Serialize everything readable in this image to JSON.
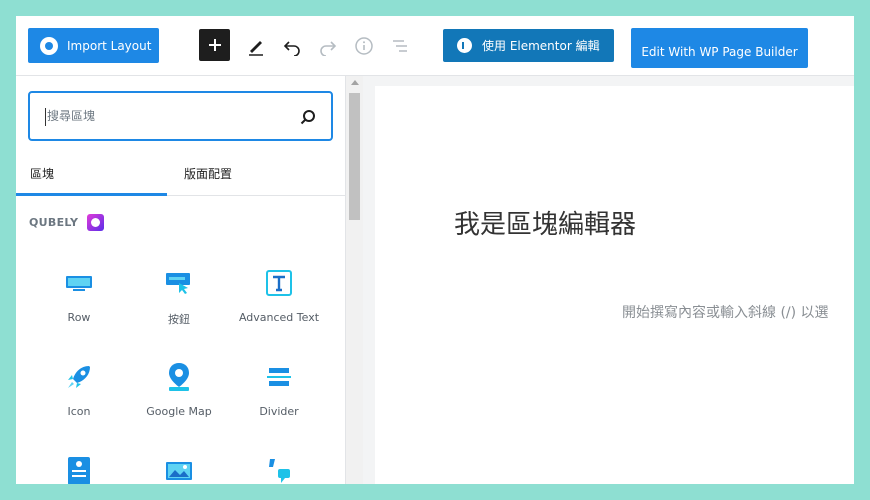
{
  "toolbar": {
    "import_layout_label": "Import Layout",
    "elementor_label": "使用 Elementor 編輯",
    "wp_page_builder_label": "Edit With WP Page Builder",
    "icons": [
      "add-block-icon",
      "pencil-icon",
      "undo-icon",
      "redo-icon",
      "info-icon",
      "outline-list-icon"
    ]
  },
  "sidebar": {
    "search": {
      "placeholder": "搜尋區塊",
      "value": ""
    },
    "tabs": [
      {
        "label": "區塊",
        "active": true
      },
      {
        "label": "版面配置",
        "active": false
      }
    ],
    "section_title": "QUBELY",
    "blocks": [
      {
        "label": "Row",
        "icon": "row-icon"
      },
      {
        "label": "按鈕",
        "icon": "button-icon"
      },
      {
        "label": "Advanced Text",
        "icon": "advanced-text-icon"
      },
      {
        "label": "Icon",
        "icon": "rocket-icon"
      },
      {
        "label": "Google Map",
        "icon": "map-pin-icon"
      },
      {
        "label": "Divider",
        "icon": "divider-icon"
      },
      {
        "label": "",
        "icon": "contact-form-icon"
      },
      {
        "label": "",
        "icon": "image-icon"
      },
      {
        "label": "",
        "icon": "testimonial-icon"
      }
    ]
  },
  "editor": {
    "title": "我是區塊編輯器",
    "placeholder": "開始撰寫內容或輸入斜線 (/) 以選"
  },
  "colors": {
    "accent": "#1e88e5",
    "elementor": "#1277b8",
    "background": "#8edfd2",
    "icon_blue": "#1a8fe3",
    "icon_cyan": "#1ec2e8"
  }
}
